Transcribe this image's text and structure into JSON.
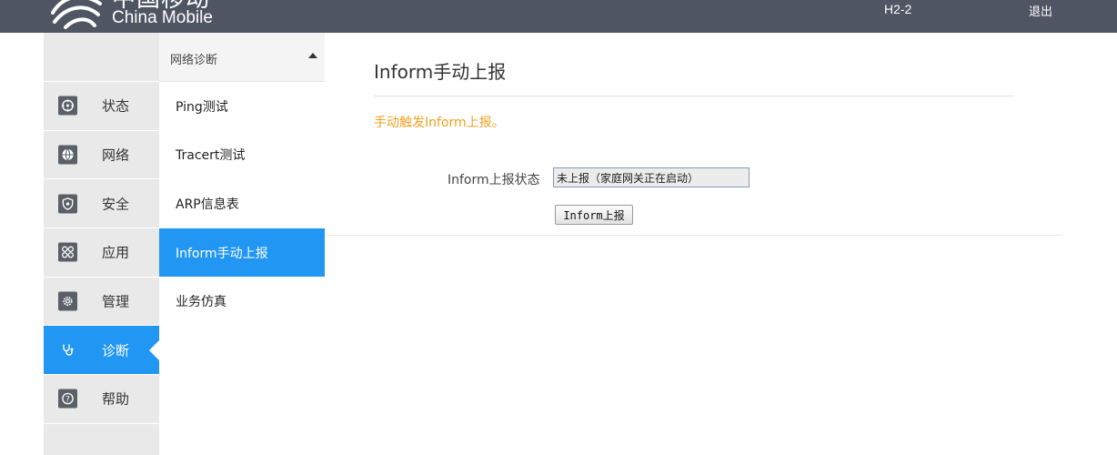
{
  "header": {
    "brand_cn": "中国移动",
    "brand_en": "China Mobile",
    "device_model": "H2-2",
    "logout_label": "退出",
    "background_color": "#4f5563"
  },
  "main_nav": {
    "items": [
      {
        "label": "状态",
        "icon": "target-icon"
      },
      {
        "label": "网络",
        "icon": "globe-icon"
      },
      {
        "label": "安全",
        "icon": "shield-icon"
      },
      {
        "label": "应用",
        "icon": "apps-grid-icon"
      },
      {
        "label": "管理",
        "icon": "gear-icon"
      },
      {
        "label": "诊断",
        "icon": "stethoscope-icon",
        "active": true
      },
      {
        "label": "帮助",
        "icon": "help-icon"
      }
    ],
    "active_color": "#2196f3"
  },
  "sub_nav": {
    "title": "网络诊断",
    "items": [
      {
        "label": "Ping测试"
      },
      {
        "label": "Tracert测试"
      },
      {
        "label": "ARP信息表"
      },
      {
        "label": "Inform手动上报",
        "active": true
      },
      {
        "label": "业务仿真"
      }
    ]
  },
  "content": {
    "title": "Inform手动上报",
    "hint": "手动触发Inform上报。",
    "hint_color": "#f0a020",
    "status_label": "Inform上报状态",
    "status_value": "未上报（家庭网关正在启动）",
    "report_button_label": "Inform上报"
  }
}
